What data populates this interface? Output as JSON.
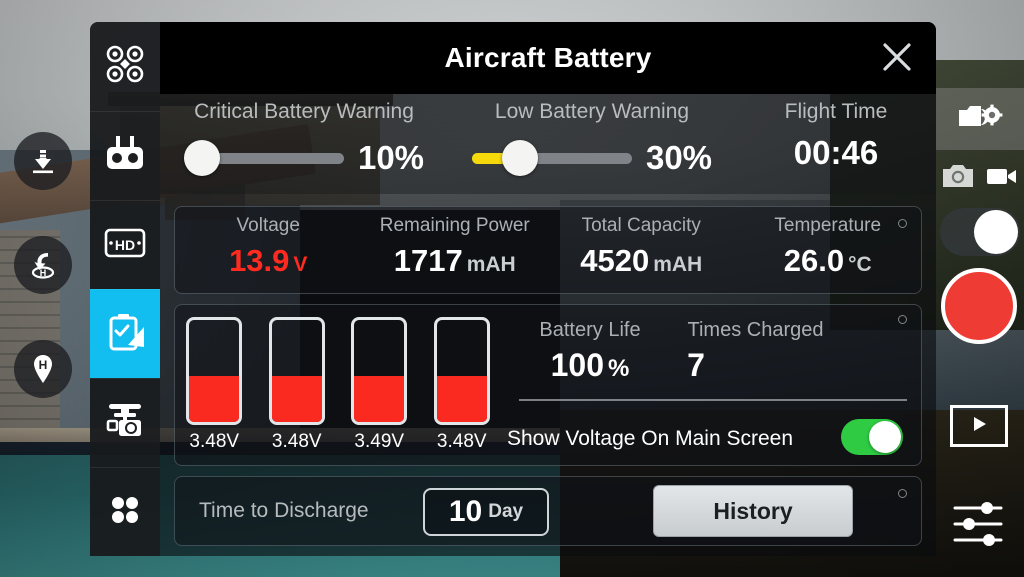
{
  "dialog": {
    "title": "Aircraft Battery",
    "close_icon": "close-icon"
  },
  "rail": {
    "items": [
      {
        "icon": "aircraft-icon",
        "label": "Aircraft",
        "active": false
      },
      {
        "icon": "remote-controller-icon",
        "label": "Remote Controller",
        "active": false
      },
      {
        "icon": "hd-transmission-icon",
        "label": "HD",
        "active": false
      },
      {
        "icon": "battery-icon",
        "label": "Battery",
        "active": true
      },
      {
        "icon": "gimbal-icon",
        "label": "Gimbal",
        "active": false
      },
      {
        "icon": "general-settings-icon",
        "label": "General",
        "active": false
      }
    ]
  },
  "warnings": {
    "critical": {
      "label": "Critical Battery Warning",
      "value": "10%",
      "percent": 10,
      "fill_color": "#f5d90a",
      "filled": false
    },
    "low": {
      "label": "Low Battery Warning",
      "value": "30%",
      "percent": 30,
      "fill_color": "#f5d90a",
      "filled": true
    },
    "flight_time": {
      "label": "Flight Time",
      "value": "00:46"
    }
  },
  "stats": [
    {
      "label": "Voltage",
      "value": "13.9",
      "unit": "V",
      "danger": true
    },
    {
      "label": "Remaining Power",
      "value": "1717",
      "unit": "mAH",
      "danger": false
    },
    {
      "label": "Total Capacity",
      "value": "4520",
      "unit": "mAH",
      "danger": false
    },
    {
      "label": "Temperature",
      "value": "26.0",
      "unit": "°C",
      "danger": false
    }
  ],
  "cells": [
    {
      "label": "3.48V",
      "level_percent": 45
    },
    {
      "label": "3.48V",
      "level_percent": 45
    },
    {
      "label": "3.49V",
      "level_percent": 45
    },
    {
      "label": "3.48V",
      "level_percent": 45
    }
  ],
  "battery_life": {
    "label": "Battery Life",
    "value": "100",
    "unit": "%"
  },
  "times_charged": {
    "label": "Times Charged",
    "value": "7"
  },
  "show_voltage": {
    "label": "Show Voltage On Main Screen",
    "on": true,
    "on_color": "#2ecb43"
  },
  "bottom": {
    "time_to_discharge_label": "Time to Discharge",
    "day_value": "10",
    "day_unit": "Day",
    "history_label": "History"
  },
  "hud": {
    "left_buttons": [
      {
        "icon": "auto-landing-icon",
        "label": "Auto Landing"
      },
      {
        "icon": "return-to-home-icon",
        "label": "Return To Home"
      },
      {
        "icon": "home-point-icon",
        "label": "Home Point"
      }
    ],
    "camera_settings_icon": "camera-settings-icon",
    "photo_mode_icon": "photo-camera-icon",
    "video_mode_icon": "video-camera-icon",
    "mode_toggle_on": true,
    "shutter_icon": "record-shutter-icon",
    "shutter_color": "#ee3b33",
    "playback_icon": "playback-play-icon",
    "adjust_icon": "adjustment-sliders-icon"
  },
  "theme": {
    "accent": "#12bdf0",
    "danger": "#ff2b20",
    "cell_fill": "#fa2a20",
    "toggle_on": "#2ecb43",
    "slider_fill": "#f5d90a"
  }
}
